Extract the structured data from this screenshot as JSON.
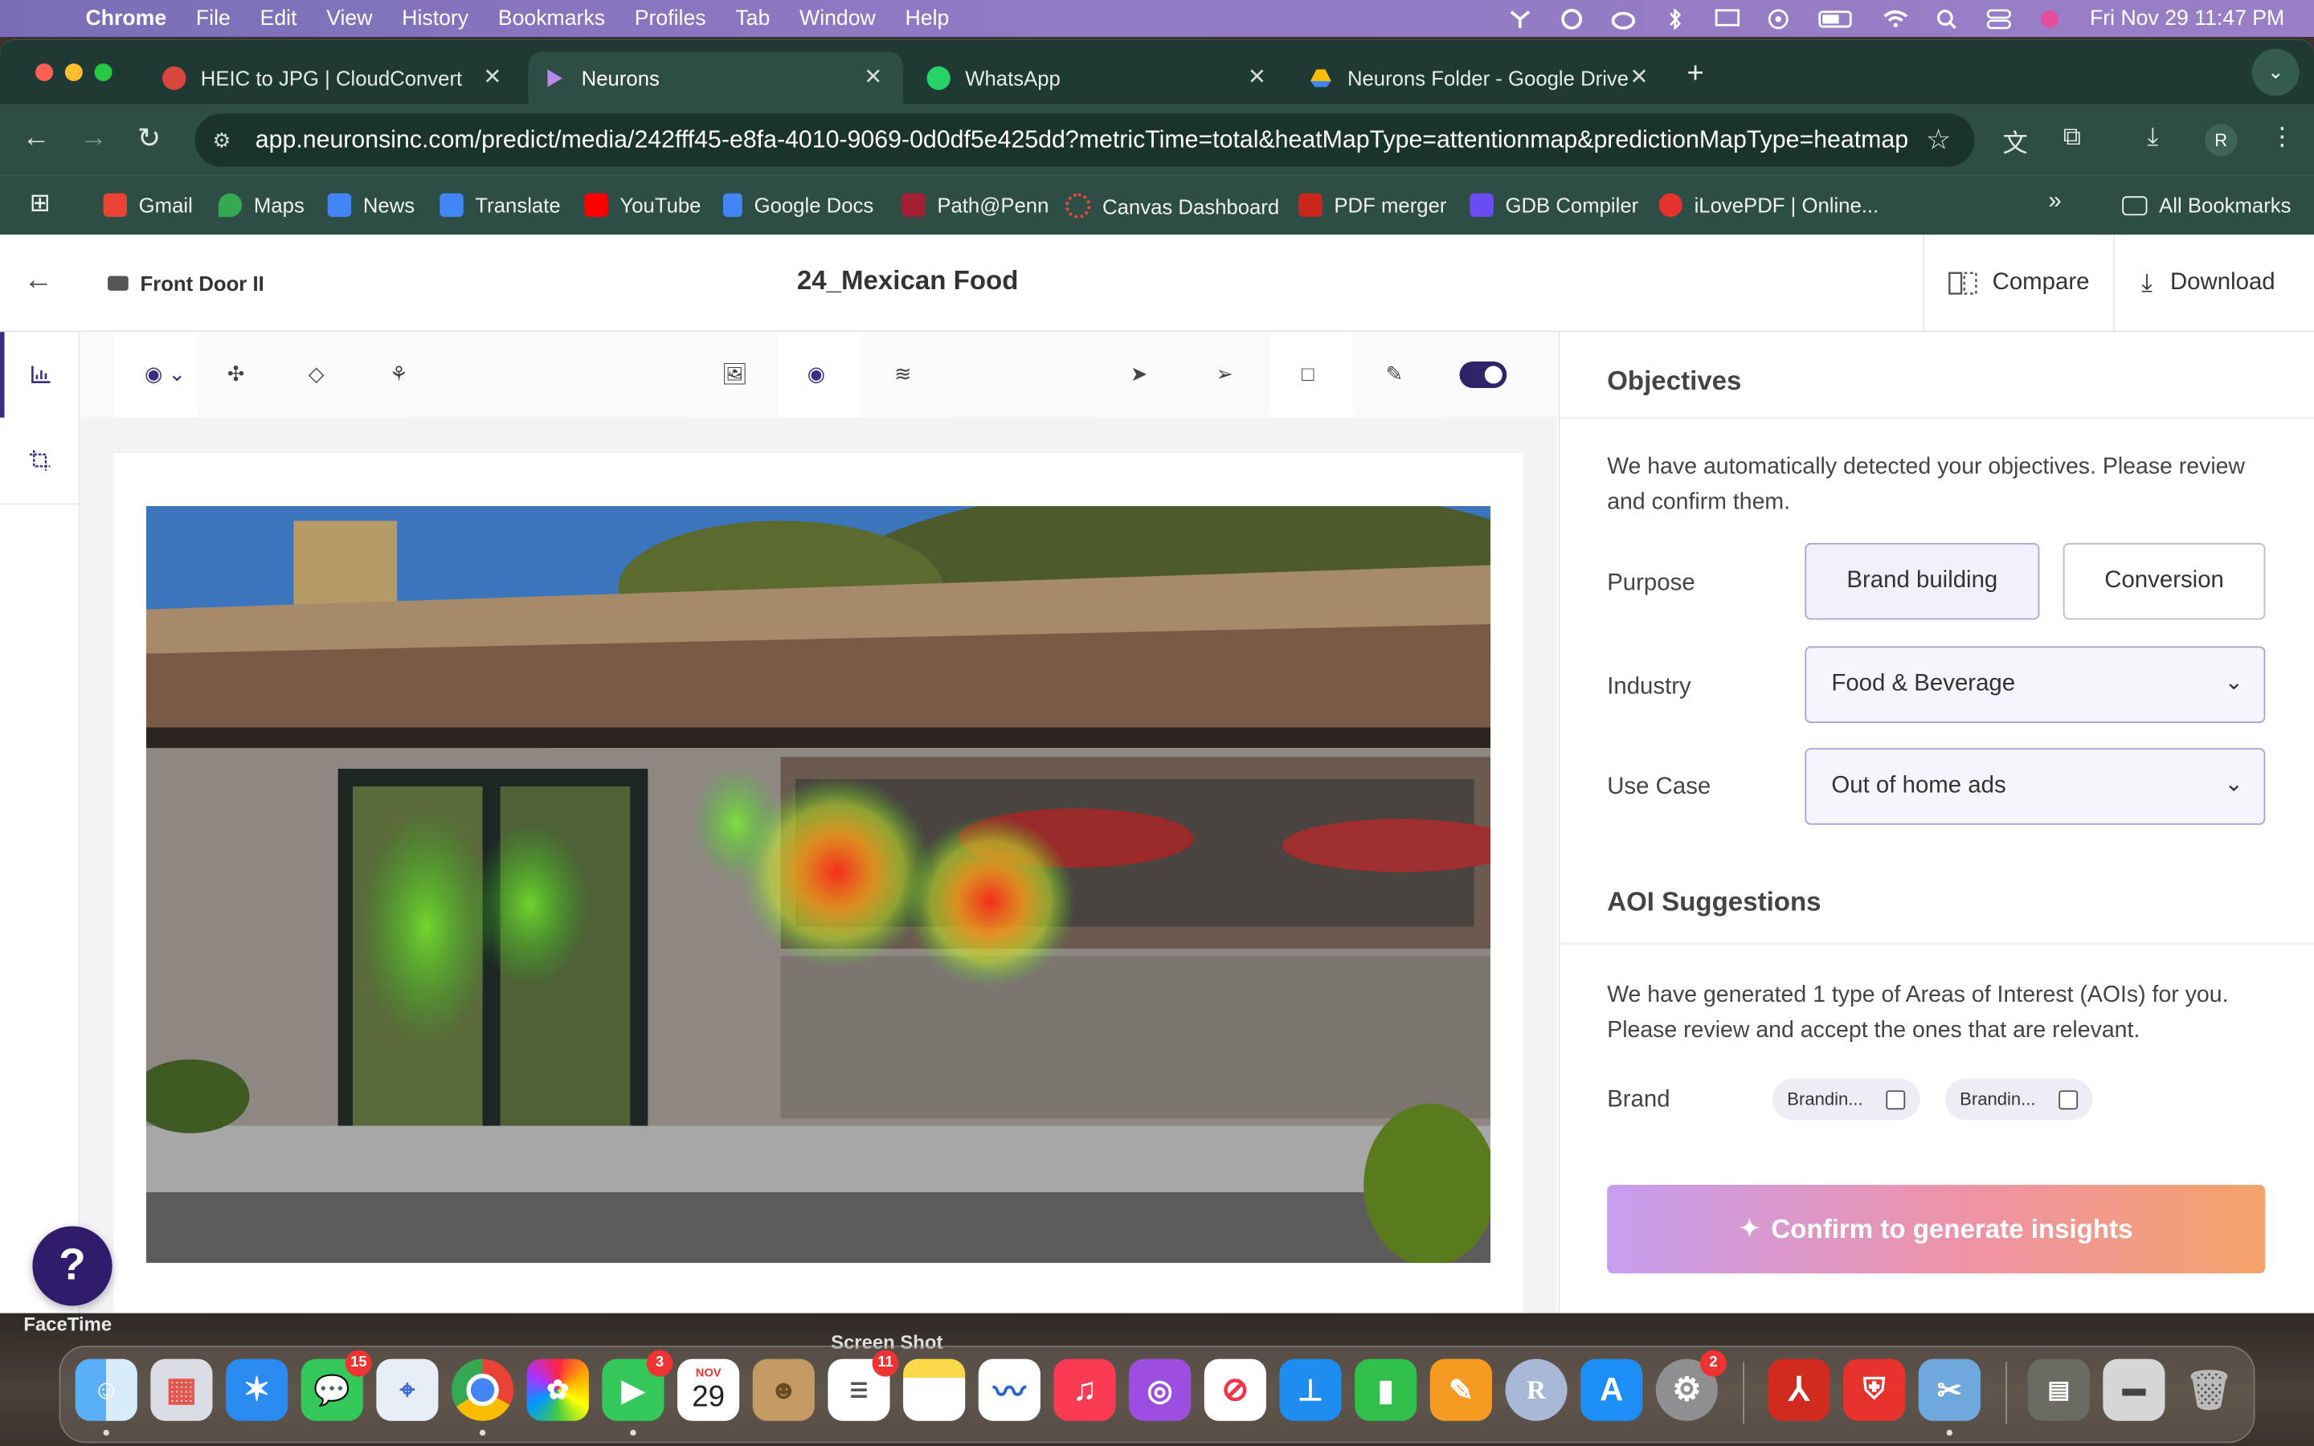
{
  "menubar": {
    "app": "Chrome",
    "items": [
      "File",
      "Edit",
      "View",
      "History",
      "Bookmarks",
      "Profiles",
      "Tab",
      "Window",
      "Help"
    ],
    "clock": "Fri Nov 29  11:47 PM"
  },
  "tabs": [
    {
      "title": "HEIC to JPG | CloudConvert",
      "active": false
    },
    {
      "title": "Neurons",
      "active": true
    },
    {
      "title": "WhatsApp",
      "active": false
    },
    {
      "title": "Neurons Folder - Google Drive",
      "active": false
    }
  ],
  "omnibox": {
    "url": "app.neuronsinc.com/predict/media/242fff45-e8fa-4010-9069-0d0df5e425dd?metricTime=total&heatMapType=attentionmap&predictionMapType=heatmap"
  },
  "profile_initial": "R",
  "bookmarks": [
    "Gmail",
    "Maps",
    "News",
    "Translate",
    "YouTube",
    "Google Docs",
    "Path@Penn",
    "Canvas Dashboard",
    "PDF merger",
    "GDB Compiler",
    "iLovePDF | Online..."
  ],
  "bookmarks_overflow": "»",
  "all_bookmarks": "All Bookmarks",
  "app": {
    "breadcrumb": "Front Door II",
    "title": "24_Mexican Food",
    "compare": "Compare",
    "download": "Download"
  },
  "objectives": {
    "heading": "Objectives",
    "description": "We have automatically detected your objectives. Please review and confirm them.",
    "purpose_label": "Purpose",
    "purpose_options": [
      "Brand building",
      "Conversion"
    ],
    "industry_label": "Industry",
    "industry_value": "Food & Beverage",
    "usecase_label": "Use Case",
    "usecase_value": "Out of home ads"
  },
  "aoi": {
    "heading": "AOI Suggestions",
    "description": "We have generated 1 type of Areas of Interest (AOIs) for you. Please review and accept the ones that are relevant.",
    "brand_label": "Brand",
    "chips": [
      "Brandin...",
      "Brandin..."
    ],
    "confirm": "Confirm to generate insights"
  },
  "help": "?",
  "desktop": {
    "facetime": "FaceTime",
    "screenshot": "Screen Shot"
  },
  "dock": {
    "badges": {
      "messages": "15",
      "facetime": "3",
      "reminders": "11",
      "settings": "2"
    },
    "calendar_month": "NOV",
    "calendar_day": "29"
  }
}
